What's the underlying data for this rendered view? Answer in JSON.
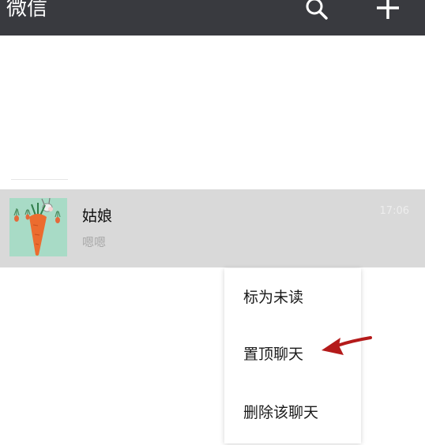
{
  "header": {
    "title": "微信",
    "search_icon": "search-icon",
    "add_icon": "plus-icon",
    "background": "#393a3f"
  },
  "chat": {
    "name": "姑娘",
    "preview": "嗯嗯",
    "time": "17:06",
    "avatar_icon": "carrot-avatar"
  },
  "context_menu": {
    "items": [
      {
        "label": "标为未读"
      },
      {
        "label": "置顶聊天"
      },
      {
        "label": "删除该聊天"
      }
    ]
  },
  "annotation": {
    "arrow_color": "#b41a1a",
    "arrow_icon": "red-arrow-icon"
  }
}
